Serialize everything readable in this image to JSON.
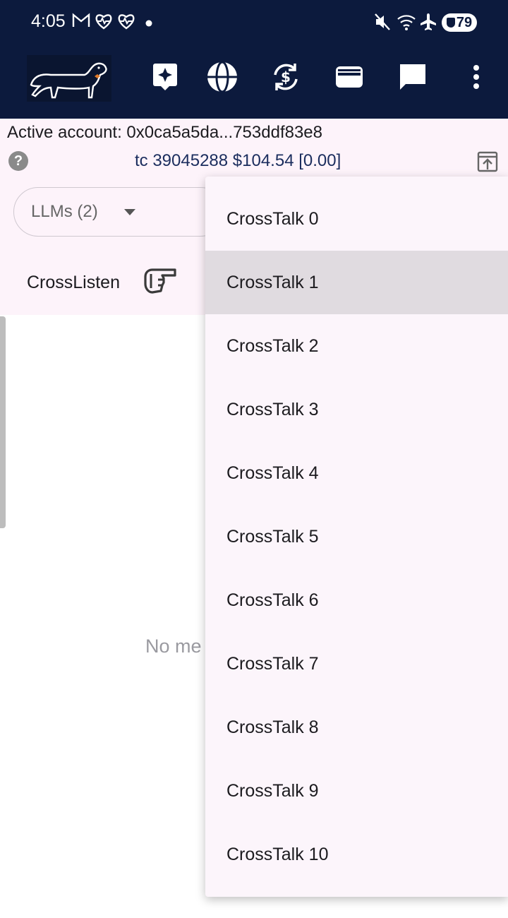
{
  "status_bar": {
    "time": "4:05",
    "battery": "79",
    "icons": [
      "gmail-icon",
      "heartbeat-icon",
      "heartbeat-icon",
      "dot-icon",
      "mute-icon",
      "wifi-icon",
      "airplane-icon",
      "battery-icon"
    ]
  },
  "app_bar": {
    "actions": [
      "sparkle-icon",
      "globe-icon",
      "currency-sync-icon",
      "wallet-icon",
      "chat-icon",
      "more-vert-icon"
    ]
  },
  "account": {
    "active_account": "Active account: 0x0ca5a5da...753ddf83e8",
    "balance": "tc 39045288 $104.54 [0.00]"
  },
  "llm_selector": {
    "label": "LLMs  (2)"
  },
  "crosslisten": {
    "label": "CrossListen"
  },
  "empty_state": {
    "text": "No me"
  },
  "menu": {
    "items": [
      {
        "label": "CrossTalk 0"
      },
      {
        "label": "CrossTalk 1"
      },
      {
        "label": "CrossTalk 2"
      },
      {
        "label": "CrossTalk 3"
      },
      {
        "label": "CrossTalk 4"
      },
      {
        "label": "CrossTalk 5"
      },
      {
        "label": "CrossTalk 6"
      },
      {
        "label": "CrossTalk 7"
      },
      {
        "label": "CrossTalk 8"
      },
      {
        "label": "CrossTalk 9"
      },
      {
        "label": "CrossTalk 10"
      }
    ],
    "selected_index": 1
  },
  "colors": {
    "app_bar": "#0c1a3d",
    "info_background": "#fdf3fa",
    "menu_background": "#fcf5fb",
    "menu_selected": "#e0dbe0",
    "balance_text": "#1b2d5e"
  }
}
